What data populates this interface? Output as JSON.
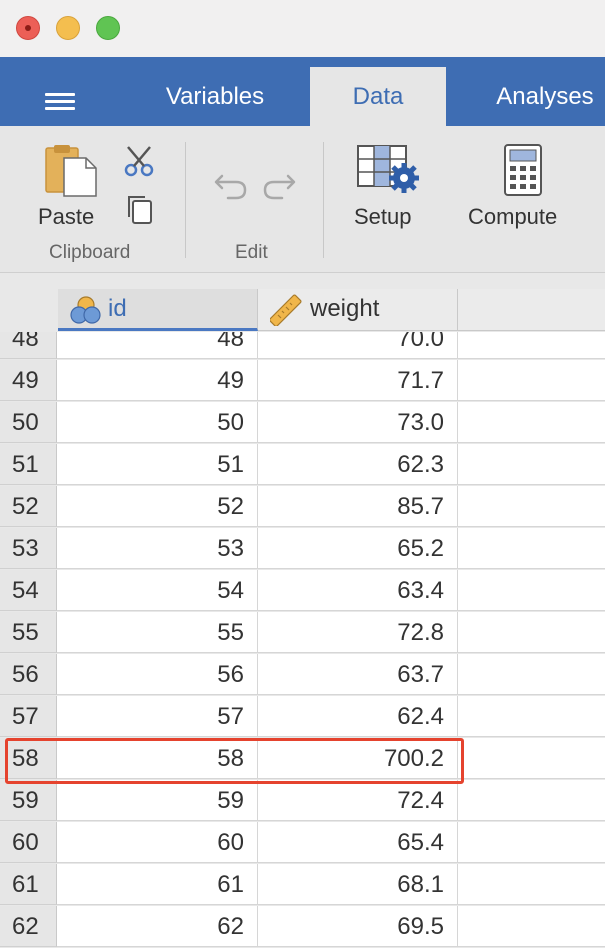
{
  "window": {
    "controls": [
      "close",
      "minimize",
      "zoom"
    ]
  },
  "tabs": [
    {
      "label": "Variables"
    },
    {
      "label": "Data"
    },
    {
      "label": "Analyses"
    }
  ],
  "active_tab": "Data",
  "ribbon": {
    "paste": "Paste",
    "clipboard_group": "Clipboard",
    "edit_group": "Edit",
    "setup": "Setup",
    "compute": "Compute"
  },
  "columns": [
    {
      "name": "id",
      "icon": "nominal-variable-icon"
    },
    {
      "name": "weight",
      "icon": "ruler-continuous-icon"
    }
  ],
  "rows": [
    {
      "row": "48",
      "id": "48",
      "weight": "70.0"
    },
    {
      "row": "49",
      "id": "49",
      "weight": "71.7"
    },
    {
      "row": "50",
      "id": "50",
      "weight": "73.0"
    },
    {
      "row": "51",
      "id": "51",
      "weight": "62.3"
    },
    {
      "row": "52",
      "id": "52",
      "weight": "85.7"
    },
    {
      "row": "53",
      "id": "53",
      "weight": "65.2"
    },
    {
      "row": "54",
      "id": "54",
      "weight": "63.4"
    },
    {
      "row": "55",
      "id": "55",
      "weight": "72.8"
    },
    {
      "row": "56",
      "id": "56",
      "weight": "63.7"
    },
    {
      "row": "57",
      "id": "57",
      "weight": "62.4"
    },
    {
      "row": "58",
      "id": "58",
      "weight": "700.2"
    },
    {
      "row": "59",
      "id": "59",
      "weight": "72.4"
    },
    {
      "row": "60",
      "id": "60",
      "weight": "65.4"
    },
    {
      "row": "61",
      "id": "61",
      "weight": "68.1"
    },
    {
      "row": "62",
      "id": "62",
      "weight": "69.5"
    }
  ],
  "highlighted_row": "58",
  "colors": {
    "accent": "#3e6db3",
    "highlight": "#e5432e"
  }
}
